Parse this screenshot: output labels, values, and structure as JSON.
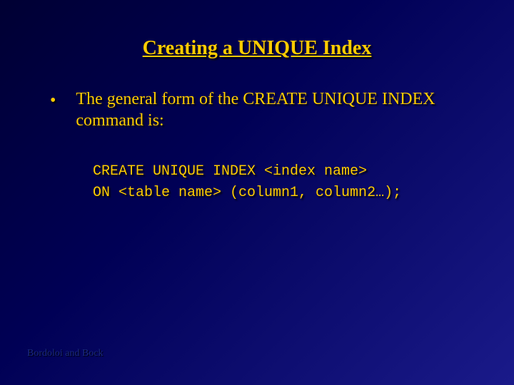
{
  "title": "Creating a UNIQUE Index",
  "bullet": {
    "mark": "•",
    "text": "The general form of the CREATE UNIQUE INDEX command is:"
  },
  "code": {
    "line1": "CREATE UNIQUE INDEX <index name>",
    "line2": "ON <table name> (column1, column2…);"
  },
  "footer": "Bordoloi and Bock"
}
